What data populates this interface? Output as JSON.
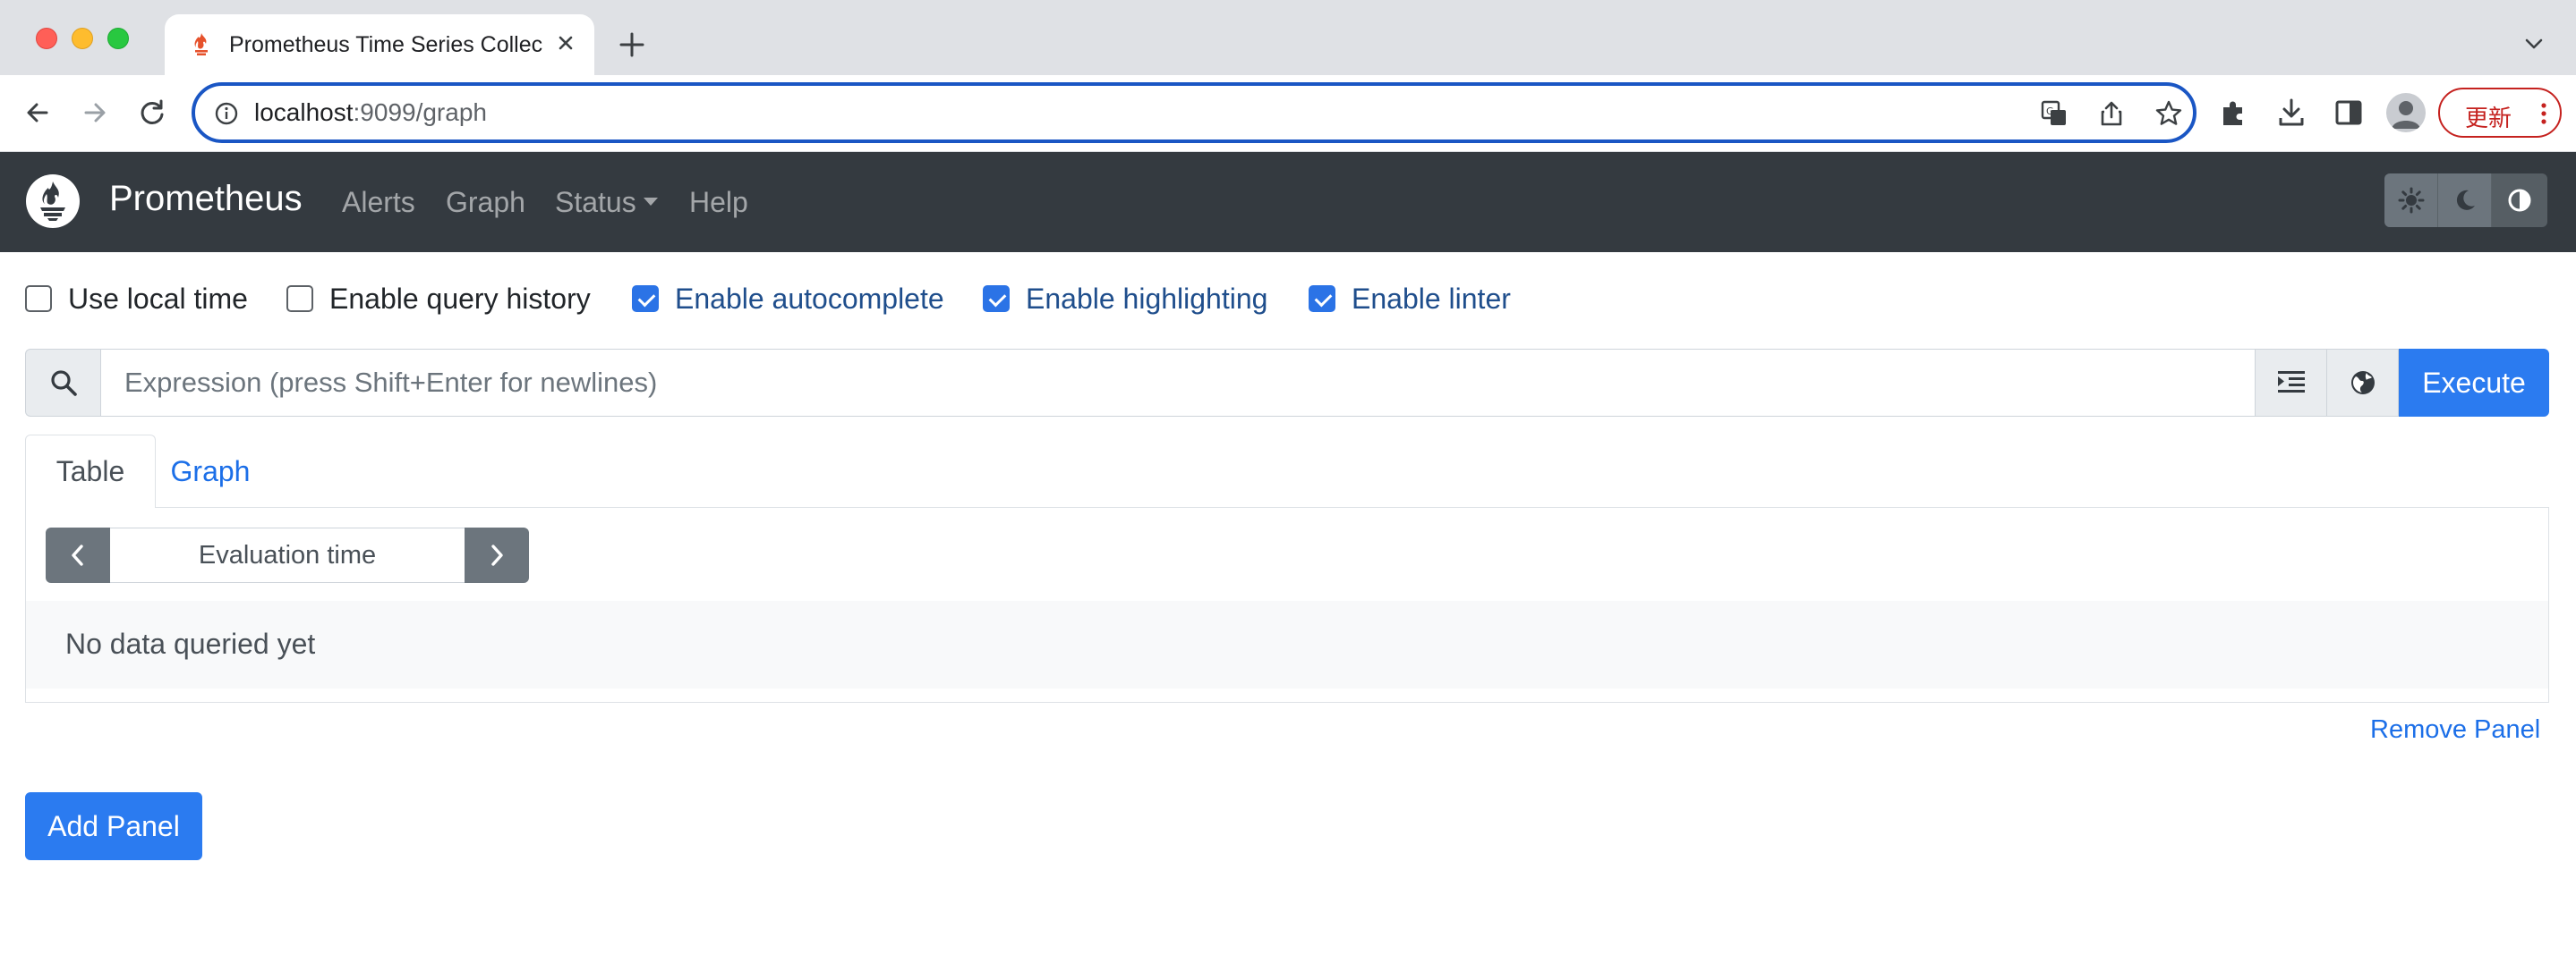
{
  "browser": {
    "tab_title": "Prometheus Time Series Collect",
    "url_host": "localhost",
    "url_rest": ":9099/graph",
    "update_label": "更新"
  },
  "navbar": {
    "brand": "Prometheus",
    "links": [
      "Alerts",
      "Graph",
      "Status",
      "Help"
    ]
  },
  "options": {
    "use_local_time": {
      "label": "Use local time",
      "checked": false
    },
    "query_history": {
      "label": "Enable query history",
      "checked": false
    },
    "autocomplete": {
      "label": "Enable autocomplete",
      "checked": true
    },
    "highlighting": {
      "label": "Enable highlighting",
      "checked": true
    },
    "linter": {
      "label": "Enable linter",
      "checked": true
    }
  },
  "expression": {
    "placeholder": "Expression (press Shift+Enter for newlines)",
    "execute_label": "Execute"
  },
  "panel": {
    "tabs": [
      "Table",
      "Graph"
    ],
    "active_tab": "Table",
    "eval_time_placeholder": "Evaluation time",
    "empty_message": "No data queried yet",
    "remove_label": "Remove Panel"
  },
  "add_panel_label": "Add Panel",
  "colors": {
    "navbar_bg": "#343a40",
    "primary": "#2b7bf0",
    "link": "#1c6fe8"
  }
}
